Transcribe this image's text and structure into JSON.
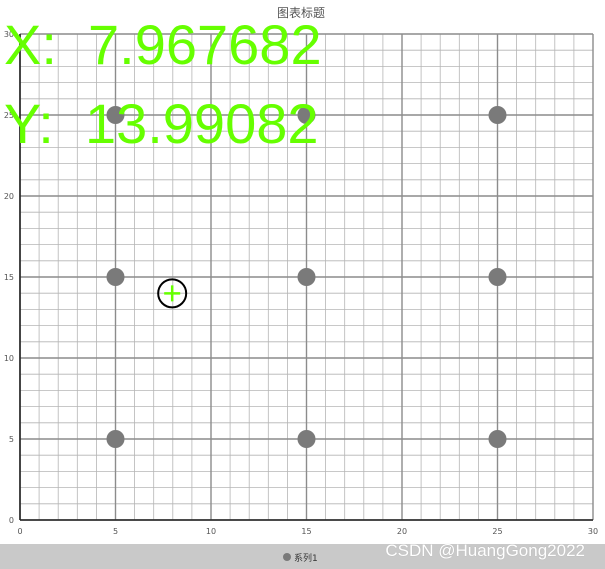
{
  "chart_data": {
    "type": "scatter",
    "title": "图表标题",
    "xlabel": "",
    "ylabel": "",
    "xlim": [
      0,
      30
    ],
    "ylim": [
      0,
      30
    ],
    "x_ticks": [
      0,
      5,
      10,
      15,
      20,
      25,
      30
    ],
    "y_ticks": [
      0,
      5,
      10,
      15,
      20,
      25,
      30
    ],
    "grid": true,
    "minor_grid": true,
    "legend_position": "bottom",
    "series": [
      {
        "name": "系列1",
        "color": "#7a7a7a",
        "points": [
          {
            "x": 5,
            "y": 5
          },
          {
            "x": 5,
            "y": 15
          },
          {
            "x": 5,
            "y": 25
          },
          {
            "x": 15,
            "y": 5
          },
          {
            "x": 15,
            "y": 15
          },
          {
            "x": 15,
            "y": 25
          },
          {
            "x": 25,
            "y": 5
          },
          {
            "x": 25,
            "y": 15
          },
          {
            "x": 25,
            "y": 25
          }
        ]
      }
    ]
  },
  "cursor": {
    "x": 7.967682,
    "y": 13.99082,
    "x_readout": "X:  7.967682",
    "y_readout": "Y:  13.99082",
    "readout_color": "#66ff00"
  },
  "watermark": "CSDN @HuangGong2022",
  "legend": {
    "series_label": "系列1"
  }
}
